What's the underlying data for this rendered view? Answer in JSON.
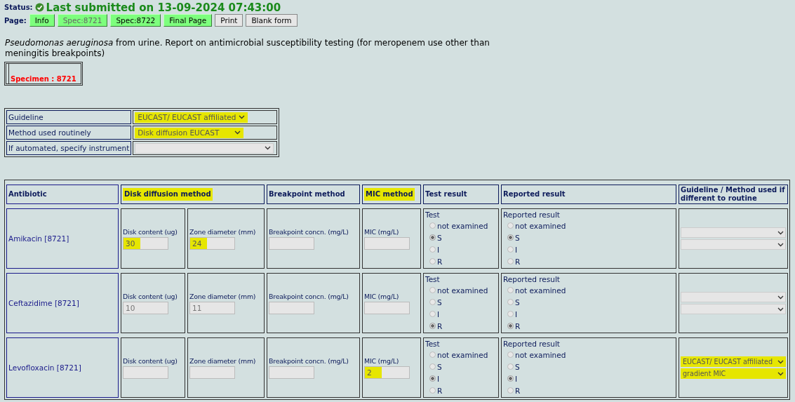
{
  "status": {
    "label": "Status:",
    "text": "Last submitted on 13-09-2024 07:43:00"
  },
  "page_nav": {
    "label": "Page:",
    "buttons": [
      {
        "label": "Info",
        "kind": "page",
        "selected": false
      },
      {
        "label": "Spec:8721",
        "kind": "page",
        "selected": true
      },
      {
        "label": "Spec:8722",
        "kind": "page",
        "selected": false
      },
      {
        "label": "Final Page",
        "kind": "page",
        "selected": false
      },
      {
        "label": "Print",
        "kind": "action",
        "selected": false
      },
      {
        "label": "Blank form",
        "kind": "action",
        "selected": false
      }
    ]
  },
  "description": "*Pseudomonas aeruginosa* from urine. Report on antimicrobial susceptibility testing (for meropenem use other than meningitis breakpoints)",
  "specimen": "Specimen : 8721",
  "settings": [
    {
      "label": "Guideline",
      "value": "EUCAST/ EUCAST affiliated",
      "highlighted": true
    },
    {
      "label": "Method used routinely",
      "value": "Disk diffusion EUCAST",
      "highlighted": true
    },
    {
      "label": "If automated, specify instrument",
      "highlighted": false
    }
  ],
  "table": {
    "columns": [
      {
        "label": "Antibiotic",
        "highlighted": false
      },
      {
        "label": "Disk diffusion method",
        "highlighted": true
      },
      {
        "label": "Breakpoint method",
        "highlighted": false
      },
      {
        "label": "MIC method",
        "highlighted": true
      },
      {
        "label": "Test result",
        "highlighted": false
      },
      {
        "label": "Reported result",
        "highlighted": false
      },
      {
        "label": "Guideline / Method used if different to routine",
        "highlighted": false
      }
    ],
    "rows": [
      {
        "name": "Amikacin [8721]",
        "fields": [
          {
            "label": "Disk content (ug)",
            "value": "30",
            "highlighted": true
          },
          {
            "label": "Zone diameter (mm)",
            "value": "24",
            "highlighted": true
          },
          {
            "label": "Breakpoint concn. (mg/L)",
            "highlighted": false
          },
          {
            "label": "MIC (mg/L)",
            "highlighted": false
          }
        ],
        "test": {
          "label": "Test",
          "options": [
            {
              "label": "not examined",
              "selected": false
            },
            {
              "label": "S",
              "selected": true
            },
            {
              "label": "I",
              "selected": false
            },
            {
              "label": "R",
              "selected": false
            }
          ]
        },
        "reported": {
          "label": "Reported result",
          "options": [
            {
              "label": "not examined",
              "selected": false
            },
            {
              "label": "S",
              "selected": true
            },
            {
              "label": "I",
              "selected": false
            },
            {
              "label": "R",
              "selected": false
            }
          ]
        },
        "override": [
          {
            "highlighted": false
          },
          {
            "highlighted": false
          }
        ]
      },
      {
        "name": "Ceftazidime [8721]",
        "fields": [
          {
            "label": "Disk content (ug)",
            "value": "10",
            "highlighted": false
          },
          {
            "label": "Zone diameter (mm)",
            "value": "11",
            "highlighted": false
          },
          {
            "label": "Breakpoint concn. (mg/L)",
            "highlighted": false
          },
          {
            "label": "MIC (mg/L)",
            "highlighted": false
          }
        ],
        "test": {
          "label": "Test",
          "options": [
            {
              "label": "not examined",
              "selected": false
            },
            {
              "label": "S",
              "selected": false
            },
            {
              "label": "I",
              "selected": false
            },
            {
              "label": "R",
              "selected": true
            }
          ]
        },
        "reported": {
          "label": "Reported result",
          "options": [
            {
              "label": "not examined",
              "selected": false
            },
            {
              "label": "S",
              "selected": false
            },
            {
              "label": "I",
              "selected": false
            },
            {
              "label": "R",
              "selected": true
            }
          ]
        },
        "override": [
          {
            "highlighted": false
          },
          {
            "highlighted": false
          }
        ]
      },
      {
        "name": "Levofloxacin [8721]",
        "fields": [
          {
            "label": "Disk content (ug)",
            "highlighted": false
          },
          {
            "label": "Zone diameter (mm)",
            "highlighted": false
          },
          {
            "label": "Breakpoint concn. (mg/L)",
            "highlighted": false
          },
          {
            "label": "MIC (mg/L)",
            "value": "2",
            "highlighted": true
          }
        ],
        "test": {
          "label": "Test",
          "options": [
            {
              "label": "not examined",
              "selected": false
            },
            {
              "label": "S",
              "selected": false
            },
            {
              "label": "I",
              "selected": true
            },
            {
              "label": "R",
              "selected": false
            }
          ]
        },
        "reported": {
          "label": "Reported result",
          "options": [
            {
              "label": "not examined",
              "selected": false
            },
            {
              "label": "S",
              "selected": false
            },
            {
              "label": "I",
              "selected": true
            },
            {
              "label": "R",
              "selected": false
            }
          ]
        },
        "override": [
          {
            "value": "EUCAST/ EUCAST affiliated",
            "highlighted": true
          },
          {
            "value": "gradient MIC",
            "highlighted": true
          }
        ]
      }
    ]
  }
}
